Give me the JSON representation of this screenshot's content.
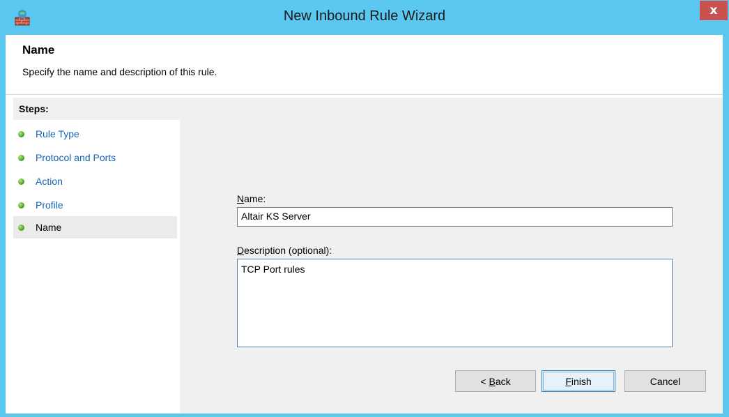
{
  "window": {
    "title": "New Inbound Rule Wizard",
    "close_glyph": "x",
    "accent": "#5ac8f0"
  },
  "header": {
    "title": "Name",
    "description": "Specify the name and description of this rule."
  },
  "steps": {
    "heading": "Steps:",
    "items": [
      {
        "label": "Rule Type",
        "state": "completed",
        "icon": "green-bullet-icon"
      },
      {
        "label": "Protocol and Ports",
        "state": "completed",
        "icon": "green-bullet-icon"
      },
      {
        "label": "Action",
        "state": "completed",
        "icon": "green-bullet-icon"
      },
      {
        "label": "Profile",
        "state": "completed",
        "icon": "green-bullet-icon"
      },
      {
        "label": "Name",
        "state": "current",
        "icon": "green-bullet-icon"
      }
    ]
  },
  "form": {
    "name_label_first": "N",
    "name_label_rest": "ame:",
    "name_value": "Altair KS Server",
    "desc_label_first": "D",
    "desc_label_rest": "escription (optional):",
    "desc_value": "TCP Port rules"
  },
  "buttons": {
    "back_prefix": "< ",
    "back_accel": "B",
    "back_rest": "ack",
    "finish_accel": "F",
    "finish_rest": "inish",
    "cancel": "Cancel"
  }
}
